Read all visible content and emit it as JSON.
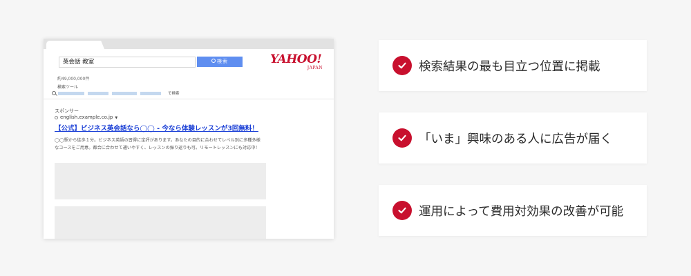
{
  "colors": {
    "accent": "#c8102e",
    "search_button": "#5f8ef0",
    "ad_link": "#1a3fd6",
    "background": "#f6f6f6"
  },
  "browser": {
    "search_query": "英会話 教室",
    "search_button_label": "検索",
    "search_button_icon": "search-icon",
    "logo": {
      "main": "YAHOO!",
      "sub": "JAPAN"
    },
    "result_count": "約49,000,000件",
    "tools_label": "検索ツール",
    "tools_suffix": "で検索",
    "ad": {
      "sponsor_label": "スポンサー",
      "url": "english.example.co.jp",
      "title": "【公式】ビジネス英会話なら◯◯ - 今なら体験レッスンが3回無料！",
      "description": "◯◯駅から徒歩１分。ビジネス英語の習得に定評があります。あなたの目的に合わせてレベル別に多種多様なコースをご用意。都合に合わせて通いやすく、レッスンの振り返りも可。リモートレッスンにも対応中！"
    }
  },
  "features": [
    {
      "icon": "check-icon",
      "text": "検索結果の最も目立つ位置に掲載"
    },
    {
      "icon": "check-icon",
      "text": "「いま」興味のある人に広告が届く"
    },
    {
      "icon": "check-icon",
      "text": "運用によって費用対効果の改善が可能"
    }
  ]
}
